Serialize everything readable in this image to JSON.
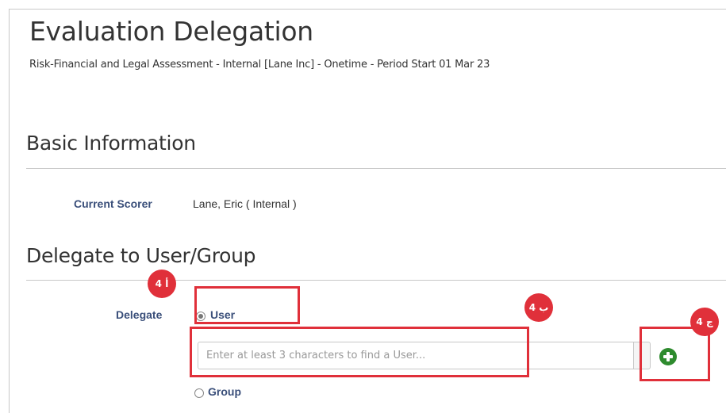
{
  "header": {
    "title": "Evaluation Delegation",
    "subtitle": "Risk-Financial and Legal Assessment - Internal [Lane Inc] - Onetime - Period Start 01 Mar 23"
  },
  "basic_info": {
    "section_title": "Basic Information",
    "current_scorer_label": "Current Scorer",
    "current_scorer_value": "Lane, Eric  ( Internal )"
  },
  "delegate": {
    "section_title": "Delegate to User/Group",
    "delegate_label": "Delegate",
    "options": [
      {
        "label": "User",
        "selected": true
      },
      {
        "label": "Group",
        "selected": false
      }
    ],
    "search_placeholder": "Enter at least 3 characters to find a User..."
  },
  "annotations": [
    {
      "label": "4 أ"
    },
    {
      "label": "4 ب"
    },
    {
      "label": "4 ج"
    }
  ],
  "colors": {
    "highlight": "#e0303a",
    "label_text": "#3a4f7a",
    "add_button": "#2e8b2e"
  }
}
